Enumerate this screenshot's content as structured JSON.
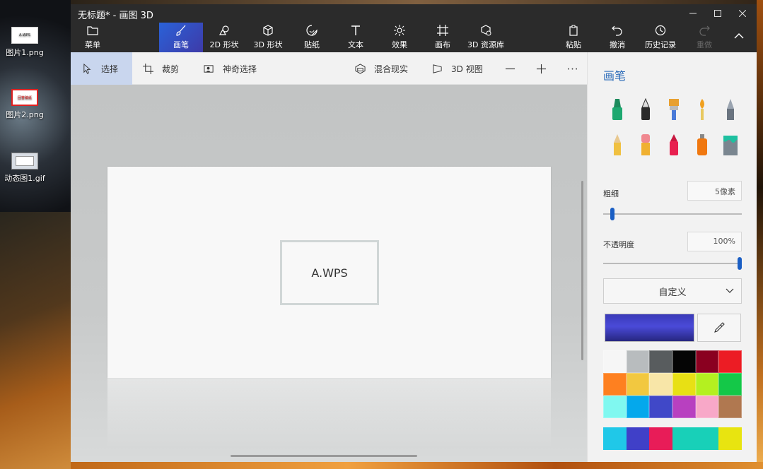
{
  "desktop": {
    "icons": [
      {
        "label": "图片1.png",
        "thumb": "A.WPS"
      },
      {
        "label": "图片2.png",
        "thumb": "回答稿纸"
      },
      {
        "label": "动态图1.gif"
      }
    ]
  },
  "window": {
    "title": "无标题* - 画图 3D"
  },
  "toolbar": {
    "items": [
      {
        "label": "菜单",
        "icon": "folder-icon"
      },
      {
        "label": "画笔",
        "icon": "brush-icon"
      },
      {
        "label": "2D 形状",
        "icon": "2d-shapes-icon"
      },
      {
        "label": "3D 形状",
        "icon": "3d-cube-icon"
      },
      {
        "label": "贴纸",
        "icon": "sticker-icon"
      },
      {
        "label": "文本",
        "icon": "text-icon"
      },
      {
        "label": "效果",
        "icon": "sun-icon"
      },
      {
        "label": "画布",
        "icon": "canvas-icon"
      },
      {
        "label": "3D 资源库",
        "icon": "3d-library-icon"
      },
      {
        "label": "粘贴",
        "icon": "paste-icon"
      },
      {
        "label": "撤消",
        "icon": "undo-icon"
      },
      {
        "label": "历史记录",
        "icon": "history-icon"
      },
      {
        "label": "重做",
        "icon": "redo-icon"
      }
    ],
    "active": "画笔"
  },
  "subbar": {
    "select": "选择",
    "crop": "裁剪",
    "magic_select": "神奇选择",
    "mixed_reality": "混合现实",
    "view3d": "3D 视图"
  },
  "canvas": {
    "box_text": "A.WPS"
  },
  "panel": {
    "title": "画笔",
    "thickness_label": "粗细",
    "thickness_value": "5像素",
    "thickness_level": 0.05,
    "opacity_label": "不透明度",
    "opacity_value": "100%",
    "opacity_level": 1.0,
    "color_mode": "自定义",
    "current_color": "#3a3ab8",
    "palette": [
      "#f6f6f6",
      "#b8bcbe",
      "#585c5e",
      "#050505",
      "#8a0020",
      "#ec1c24",
      "#fe8020",
      "#f2c840",
      "#f8e6a8",
      "#e8e014",
      "#b4f020",
      "#14c848",
      "#80f8f0",
      "#04a8ec",
      "#4048c8",
      "#b840c0",
      "#f8a8c8",
      "#b07850"
    ],
    "custom_colors": [
      "#20c8e8",
      "#4040c8",
      "#e81c58",
      "#18d0b8",
      "#e8e410"
    ]
  }
}
